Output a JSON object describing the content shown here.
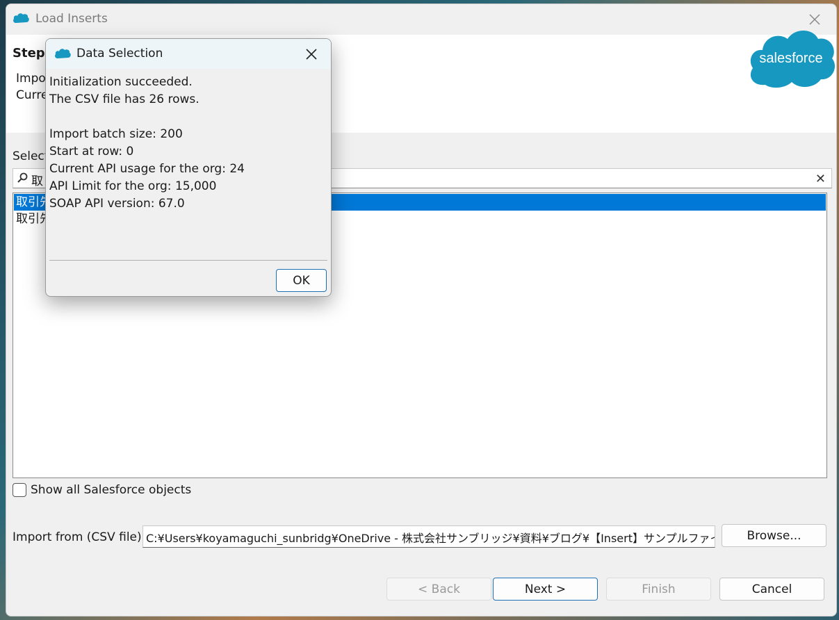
{
  "window": {
    "title": "Load Inserts"
  },
  "header": {
    "step_title": "Step",
    "line1": "Impo",
    "line2": "Curre",
    "logo_text": "salesforce"
  },
  "selection": {
    "label": "Select",
    "search_value": "取",
    "rows": [
      "取引先",
      "取引先"
    ]
  },
  "show_all_label": "Show all Salesforce objects",
  "import": {
    "label": "Import from (CSV file):",
    "path": "C:¥Users¥koyamaguchi_sunbridg¥OneDrive - 株式会社サンブリッジ¥資料¥ブログ¥【Insert】サンプルファイル.csv",
    "browse_label": "Browse..."
  },
  "buttons": {
    "back": "< Back",
    "next": "Next >",
    "finish": "Finish",
    "cancel": "Cancel"
  },
  "dialog": {
    "title": "Data Selection",
    "lines": [
      "Initialization succeeded.",
      "The CSV file has 26 rows.",
      "",
      "Import batch size: 200",
      "Start at row: 0",
      "Current API usage for the org: 24",
      "API Limit for the org: 15,000",
      "SOAP API version: 67.0"
    ],
    "ok_label": "OK"
  },
  "colors": {
    "accent": "#0078d7",
    "brand": "#1798c1"
  }
}
